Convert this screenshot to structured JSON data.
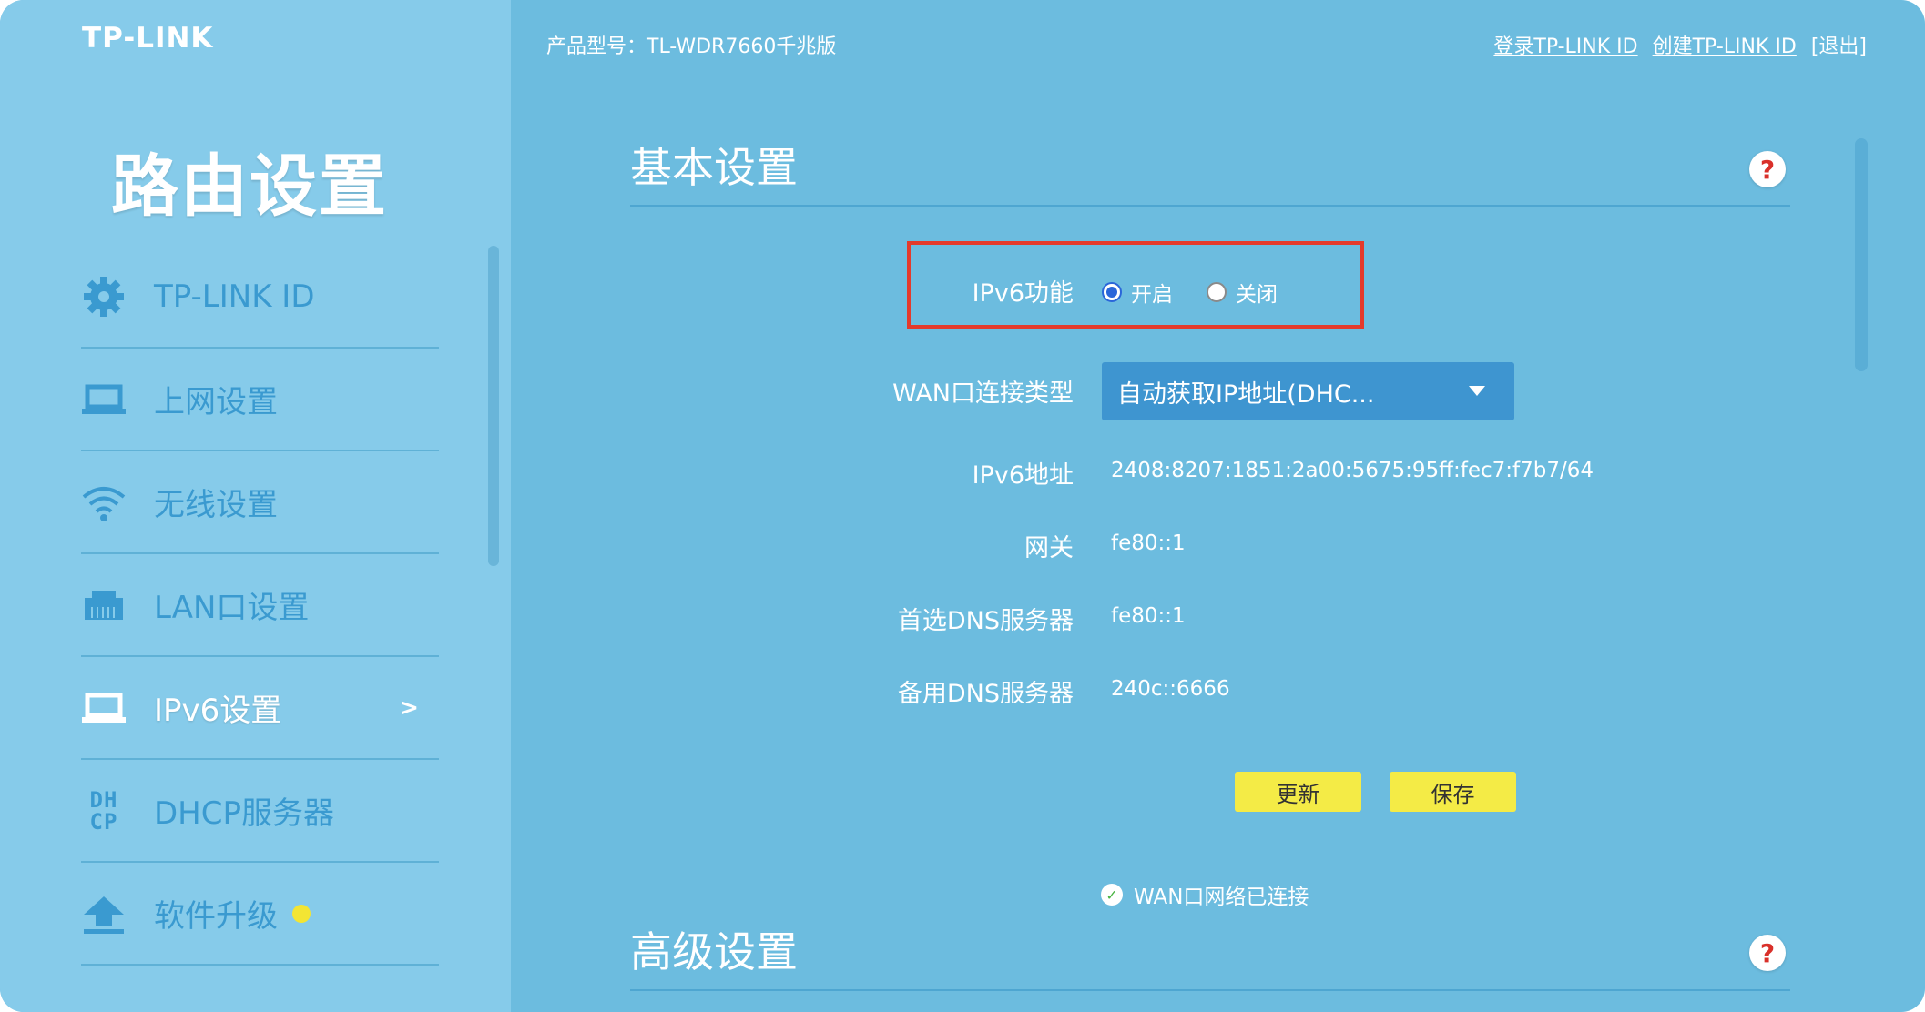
{
  "brand": {
    "logo": "TP-LINK"
  },
  "header": {
    "model_label": "产品型号：TL-WDR7660千兆版",
    "login_link": "登录TP-LINK ID",
    "create_link": "创建TP-LINK ID",
    "logout": "[退出]"
  },
  "sidebar": {
    "title": "路由设置",
    "items": [
      {
        "label": "TP-LINK ID",
        "icon": "gear-icon"
      },
      {
        "label": "上网设置",
        "icon": "laptop-icon"
      },
      {
        "label": "无线设置",
        "icon": "wifi-icon"
      },
      {
        "label": "LAN口设置",
        "icon": "lan-port-icon"
      },
      {
        "label": "IPv6设置",
        "icon": "laptop-icon",
        "active": true,
        "arrow": ">"
      },
      {
        "label": "DHCP服务器",
        "icon": "dhcp-icon",
        "icon_text_top": "DH",
        "icon_text_bottom": "CP"
      },
      {
        "label": "软件升级",
        "icon": "upload-icon",
        "badge": "update-dot"
      }
    ]
  },
  "basic": {
    "title": "基本设置",
    "help": "?",
    "ipv6_label": "IPv6功能",
    "ipv6_on": "开启",
    "ipv6_off": "关闭",
    "ipv6_selected": "开启",
    "wan_type_label": "WAN口连接类型",
    "wan_type_value": "自动获取IP地址(DHC...",
    "ipv6_addr_label": "IPv6地址",
    "ipv6_addr_value": "2408:8207:1851:2a00:5675:95ff:fec7:f7b7/64",
    "gateway_label": "网关",
    "gateway_value": "fe80::1",
    "dns1_label": "首选DNS服务器",
    "dns1_value": "fe80::1",
    "dns2_label": "备用DNS服务器",
    "dns2_value": "240c::6666",
    "refresh_button": "更新",
    "save_button": "保存",
    "status_text": "WAN口网络已连接"
  },
  "advanced": {
    "title": "高级设置",
    "help": "?"
  },
  "colors": {
    "sidebar_bg": "#86cbea",
    "content_bg": "#6cbcdf",
    "highlight_border": "#e43a2c",
    "button_bg": "#f4eb46",
    "select_bg": "#3e95d0"
  }
}
